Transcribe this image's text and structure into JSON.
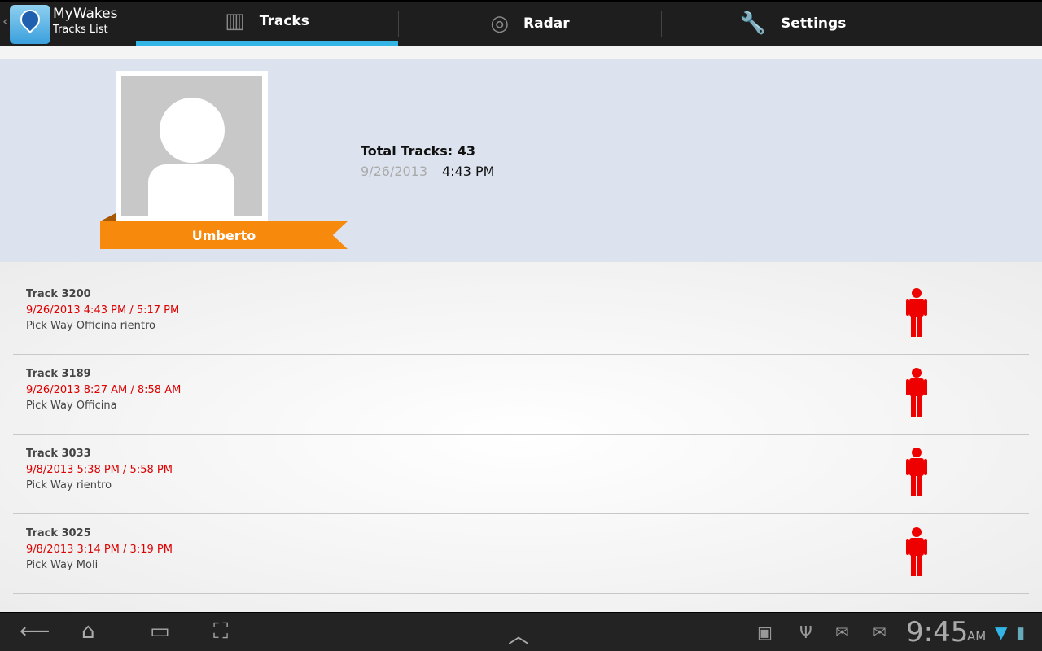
{
  "app": {
    "title": "MyWakes",
    "subtitle": "Tracks List"
  },
  "tabs": [
    {
      "label": "Tracks",
      "icon": "map-icon",
      "active": true
    },
    {
      "label": "Radar",
      "icon": "radar-icon"
    },
    {
      "label": "Settings",
      "icon": "wrench-icon"
    }
  ],
  "profile": {
    "name": "Umberto",
    "total": "Total Tracks: 43",
    "date": "9/26/2013",
    "time": "4:43 PM"
  },
  "tracks": [
    {
      "title": "Track 3200",
      "time": "9/26/2013 4:43 PM / 5:17 PM",
      "desc": "Pick Way Officina rientro"
    },
    {
      "title": "Track 3189",
      "time": "9/26/2013 8:27 AM / 8:58 AM",
      "desc": "Pick Way Officina"
    },
    {
      "title": "Track 3033",
      "time": "9/8/2013 5:38 PM / 5:58 PM",
      "desc": "Pick Way rientro"
    },
    {
      "title": "Track 3025",
      "time": "9/8/2013 3:14 PM / 3:19 PM",
      "desc": "Pick Way Moli"
    }
  ],
  "colors": {
    "accent": "#33b5e5",
    "ribbon": "#f7890c",
    "track_date": "#dd0000",
    "person": "#ee0000"
  },
  "status": {
    "clock": "9:45",
    "ampm": "AM"
  }
}
